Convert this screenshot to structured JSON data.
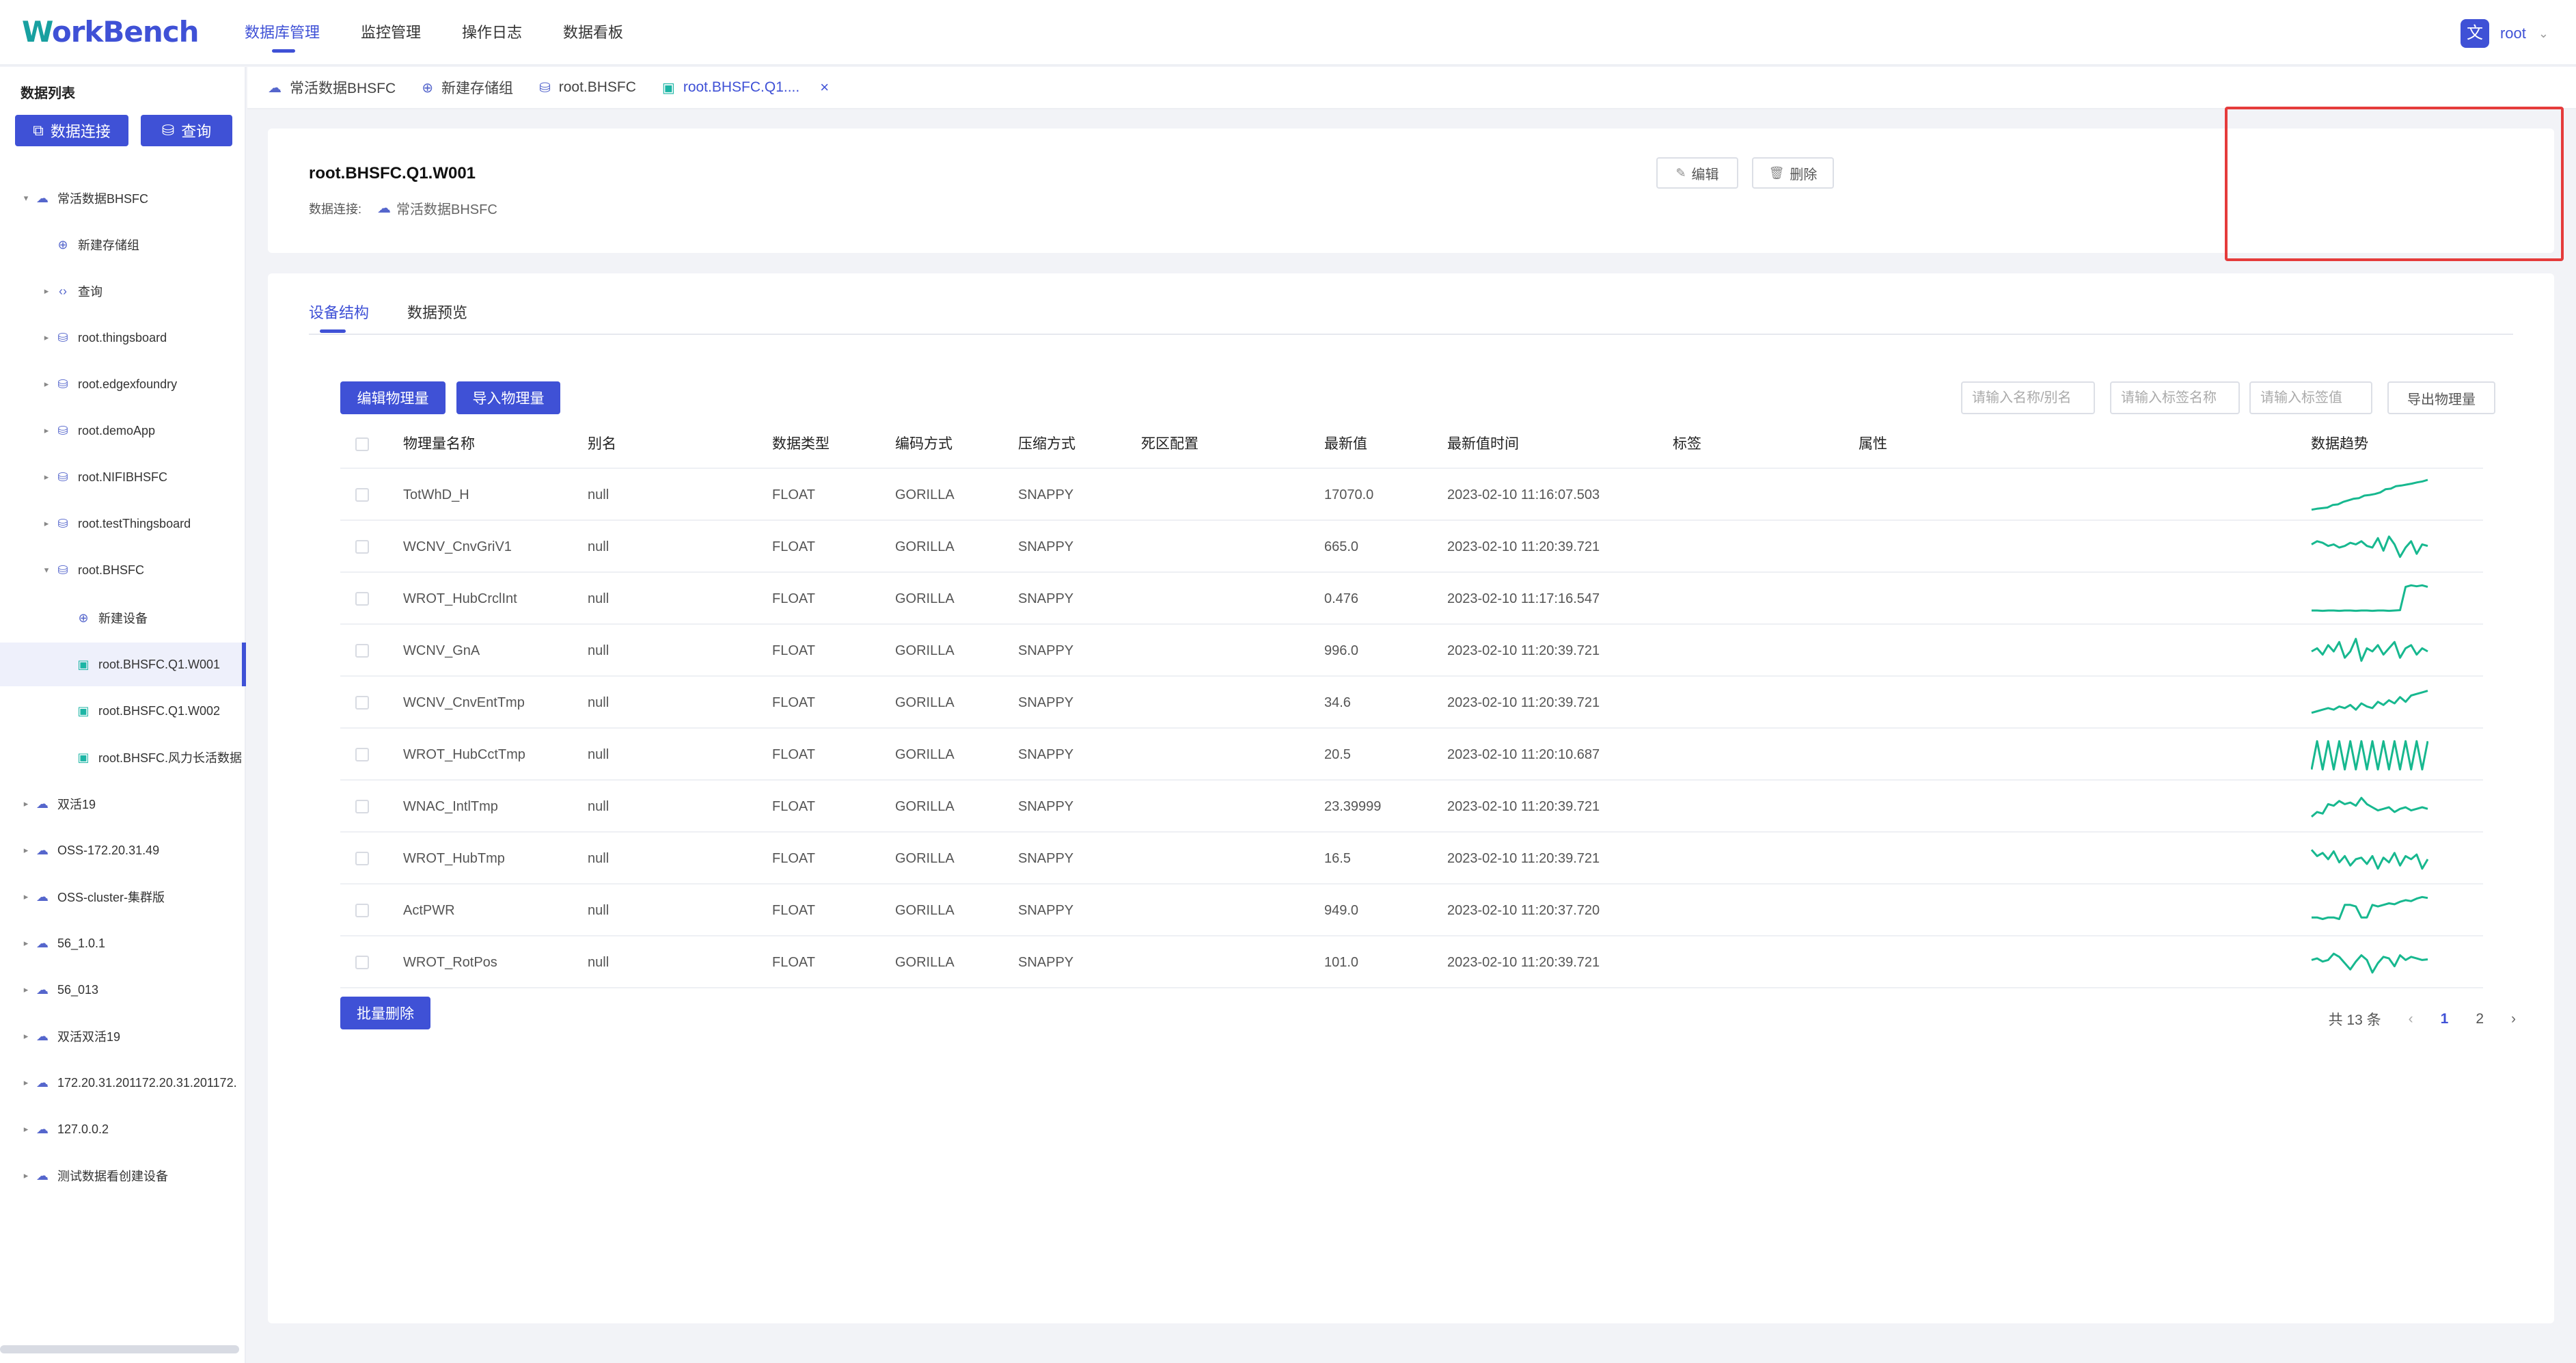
{
  "header": {
    "logo_w": "W",
    "logo_rest": "orkBench",
    "nav": [
      "数据库管理",
      "监控管理",
      "操作日志",
      "数据看板"
    ],
    "user": {
      "avatar_glyph": "文",
      "name": "root",
      "caret": "⌄"
    }
  },
  "sidebar": {
    "title": "数据列表",
    "connect_button": "数据连接",
    "query_button": "查询",
    "tree": [
      {
        "label": "常活数据BHSFC",
        "level": 0,
        "caret": "▾",
        "icon": "cloud-db-icon"
      },
      {
        "label": "新建存储组",
        "level": 1,
        "caret": "",
        "icon": "add-circle-icon"
      },
      {
        "label": "查询",
        "level": 1,
        "caret": "▸",
        "icon": "code-icon"
      },
      {
        "label": "root.thingsboard",
        "level": 1,
        "caret": "▸",
        "icon": "database-icon"
      },
      {
        "label": "root.edgexfoundry",
        "level": 1,
        "caret": "▸",
        "icon": "database-icon"
      },
      {
        "label": "root.demoApp",
        "level": 1,
        "caret": "▸",
        "icon": "database-icon"
      },
      {
        "label": "root.NIFIBHSFC",
        "level": 1,
        "caret": "▸",
        "icon": "database-icon"
      },
      {
        "label": "root.testThingsboard",
        "level": 1,
        "caret": "▸",
        "icon": "database-icon"
      },
      {
        "label": "root.BHSFC",
        "level": 1,
        "caret": "▾",
        "icon": "database-icon"
      },
      {
        "label": "新建设备",
        "level": 2,
        "caret": "",
        "icon": "add-circle-icon"
      },
      {
        "label": "root.BHSFC.Q1.W001",
        "level": 2,
        "caret": "",
        "icon": "device-icon",
        "selected": true
      },
      {
        "label": "root.BHSFC.Q1.W002",
        "level": 2,
        "caret": "",
        "icon": "device-icon"
      },
      {
        "label": "root.BHSFC.风力长活数据",
        "level": 2,
        "caret": "",
        "icon": "device-icon"
      },
      {
        "label": "双活19",
        "level": 0,
        "caret": "▸",
        "icon": "cloud-db-icon"
      },
      {
        "label": "OSS-172.20.31.49",
        "level": 0,
        "caret": "▸",
        "icon": "cloud-db-icon"
      },
      {
        "label": "OSS-cluster-集群版",
        "level": 0,
        "caret": "▸",
        "icon": "cloud-db-icon"
      },
      {
        "label": "56_1.0.1",
        "level": 0,
        "caret": "▸",
        "icon": "cloud-db-icon"
      },
      {
        "label": "56_013",
        "level": 0,
        "caret": "▸",
        "icon": "cloud-db-icon"
      },
      {
        "label": "双活双活19",
        "level": 0,
        "caret": "▸",
        "icon": "cloud-db-icon"
      },
      {
        "label": "172.20.31.201172.20.31.201172.",
        "level": 0,
        "caret": "▸",
        "icon": "cloud-db-icon"
      },
      {
        "label": "127.0.0.2",
        "level": 0,
        "caret": "▸",
        "icon": "cloud-db-icon"
      },
      {
        "label": "测试数据看创建设备",
        "level": 0,
        "caret": "▸",
        "icon": "cloud-db-icon"
      }
    ]
  },
  "tabs": [
    {
      "label": "常活数据BHSFC",
      "icon": "cloud-db-icon"
    },
    {
      "label": "新建存储组",
      "icon": "add-circle-icon"
    },
    {
      "label": "root.BHSFC",
      "icon": "database-icon"
    },
    {
      "label": "root.BHSFC.Q1....",
      "icon": "device-icon",
      "active": true
    }
  ],
  "tab_close": "×",
  "info": {
    "title": "root.BHSFC.Q1.W001",
    "connection_label": "数据连接:",
    "connection_value": "常活数据BHSFC",
    "edit_button": "编辑",
    "delete_button": "删除"
  },
  "subtabs": [
    "设备结构",
    "数据预览"
  ],
  "toolbar": {
    "edit_measurements": "编辑物理量",
    "import_measurements": "导入物理量",
    "search_name_placeholder": "请输入名称/别名",
    "search_tag_name_placeholder": "请输入标签名称",
    "search_tag_value_placeholder": "请输入标签值",
    "export_button": "导出物理量"
  },
  "table": {
    "columns": [
      "物理量名称",
      "别名",
      "数据类型",
      "编码方式",
      "压缩方式",
      "死区配置",
      "最新值",
      "最新值时间",
      "标签",
      "属性",
      "数据趋势"
    ],
    "rows": [
      {
        "name": "TotWhD_H",
        "alias": "null",
        "type": "FLOAT",
        "encoding": "GORILLA",
        "compression": "SNAPPY",
        "deadband": "",
        "latest": "17070.0",
        "time": "2023-02-10 11:16:07.503",
        "tags": "",
        "attrs": "",
        "trend": [
          0.05,
          0.08,
          0.1,
          0.12,
          0.2,
          0.22,
          0.3,
          0.35,
          0.4,
          0.42,
          0.5,
          0.52,
          0.55,
          0.6,
          0.7,
          0.72,
          0.8,
          0.82,
          0.85,
          0.88,
          0.92,
          0.95,
          1
        ]
      },
      {
        "name": "WCNV_CnvGriV1",
        "alias": "null",
        "type": "FLOAT",
        "encoding": "GORILLA",
        "compression": "SNAPPY",
        "deadband": "",
        "latest": "665.0",
        "time": "2023-02-10 11:20:39.721",
        "tags": "",
        "attrs": "",
        "trend": [
          0.6,
          0.7,
          0.65,
          0.55,
          0.6,
          0.5,
          0.55,
          0.65,
          0.6,
          0.7,
          0.55,
          0.5,
          0.8,
          0.4,
          0.85,
          0.6,
          0.2,
          0.5,
          0.7,
          0.3,
          0.6,
          0.55
        ]
      },
      {
        "name": "WROT_HubCrclInt",
        "alias": "null",
        "type": "FLOAT",
        "encoding": "GORILLA",
        "compression": "SNAPPY",
        "deadband": "",
        "latest": "0.476",
        "time": "2023-02-10 11:17:16.547",
        "tags": "",
        "attrs": "",
        "trend": [
          0.15,
          0.15,
          0.14,
          0.15,
          0.15,
          0.14,
          0.15,
          0.15,
          0.14,
          0.15,
          0.15,
          0.14,
          0.15,
          0.15,
          0.14,
          0.15,
          0.16,
          0.9,
          0.95,
          0.92,
          0.95,
          0.9
        ]
      },
      {
        "name": "WCNV_GnA",
        "alias": "null",
        "type": "FLOAT",
        "encoding": "GORILLA",
        "compression": "SNAPPY",
        "deadband": "",
        "latest": "996.0",
        "time": "2023-02-10 11:20:39.721",
        "tags": "",
        "attrs": "",
        "trend": [
          0.5,
          0.6,
          0.4,
          0.7,
          0.5,
          0.8,
          0.3,
          0.5,
          0.9,
          0.2,
          0.6,
          0.5,
          0.7,
          0.4,
          0.6,
          0.8,
          0.3,
          0.6,
          0.7,
          0.4,
          0.6,
          0.5
        ]
      },
      {
        "name": "WCNV_CnvEntTmp",
        "alias": "null",
        "type": "FLOAT",
        "encoding": "GORILLA",
        "compression": "SNAPPY",
        "deadband": "",
        "latest": "34.6",
        "time": "2023-02-10 11:20:39.721",
        "tags": "",
        "attrs": "",
        "trend": [
          0.2,
          0.25,
          0.3,
          0.35,
          0.3,
          0.4,
          0.35,
          0.45,
          0.3,
          0.5,
          0.4,
          0.35,
          0.55,
          0.45,
          0.6,
          0.5,
          0.7,
          0.55,
          0.75,
          0.8,
          0.85,
          0.9
        ]
      },
      {
        "name": "WROT_HubCctTmp",
        "alias": "null",
        "type": "FLOAT",
        "encoding": "GORILLA",
        "compression": "SNAPPY",
        "deadband": "",
        "latest": "20.5",
        "time": "2023-02-10 11:20:10.687",
        "tags": "",
        "attrs": "",
        "trend": [
          0.05,
          0.95,
          0.05,
          0.95,
          0.05,
          0.95,
          0.05,
          0.95,
          0.05,
          0.95,
          0.05,
          0.95,
          0.05,
          0.95,
          0.05,
          0.95,
          0.05,
          0.95,
          0.05,
          0.95,
          0.05,
          0.95
        ]
      },
      {
        "name": "WNAC_IntlTmp",
        "alias": "null",
        "type": "FLOAT",
        "encoding": "GORILLA",
        "compression": "SNAPPY",
        "deadband": "",
        "latest": "23.39999",
        "time": "2023-02-10 11:20:39.721",
        "tags": "",
        "attrs": "",
        "trend": [
          0.2,
          0.35,
          0.3,
          0.6,
          0.55,
          0.7,
          0.6,
          0.65,
          0.55,
          0.8,
          0.6,
          0.5,
          0.4,
          0.45,
          0.5,
          0.35,
          0.45,
          0.5,
          0.4,
          0.45,
          0.5,
          0.45
        ]
      },
      {
        "name": "WROT_HubTmp",
        "alias": "null",
        "type": "FLOAT",
        "encoding": "GORILLA",
        "compression": "SNAPPY",
        "deadband": "",
        "latest": "16.5",
        "time": "2023-02-10 11:20:39.721",
        "tags": "",
        "attrs": "",
        "trend": [
          0.8,
          0.6,
          0.7,
          0.5,
          0.75,
          0.4,
          0.6,
          0.3,
          0.5,
          0.55,
          0.35,
          0.6,
          0.2,
          0.55,
          0.4,
          0.7,
          0.3,
          0.6,
          0.5,
          0.65,
          0.2,
          0.5
        ]
      },
      {
        "name": "ActPWR",
        "alias": "null",
        "type": "FLOAT",
        "encoding": "GORILLA",
        "compression": "SNAPPY",
        "deadband": "",
        "latest": "949.0",
        "time": "2023-02-10 11:20:37.720",
        "tags": "",
        "attrs": "",
        "trend": [
          0.3,
          0.3,
          0.25,
          0.3,
          0.3,
          0.25,
          0.7,
          0.7,
          0.65,
          0.3,
          0.3,
          0.7,
          0.65,
          0.7,
          0.75,
          0.72,
          0.8,
          0.85,
          0.82,
          0.9,
          0.95,
          0.92
        ]
      },
      {
        "name": "WROT_RotPos",
        "alias": "null",
        "type": "FLOAT",
        "encoding": "GORILLA",
        "compression": "SNAPPY",
        "deadband": "",
        "latest": "101.0",
        "time": "2023-02-10 11:20:39.721",
        "tags": "",
        "attrs": "",
        "trend": [
          0.6,
          0.65,
          0.55,
          0.6,
          0.8,
          0.7,
          0.5,
          0.3,
          0.55,
          0.75,
          0.6,
          0.2,
          0.5,
          0.7,
          0.65,
          0.4,
          0.75,
          0.6,
          0.7,
          0.65,
          0.6,
          0.62
        ]
      }
    ],
    "batch_delete": "批量删除"
  },
  "pagination": {
    "total": "共 13 条",
    "pages": [
      "1",
      "2"
    ],
    "current": "1",
    "prev": "‹",
    "next": "›"
  },
  "colors": {
    "primary": "#3f51d6",
    "teal": "#1cb5a5",
    "spark": "#17b88f",
    "highlight": "#e53b3b"
  }
}
